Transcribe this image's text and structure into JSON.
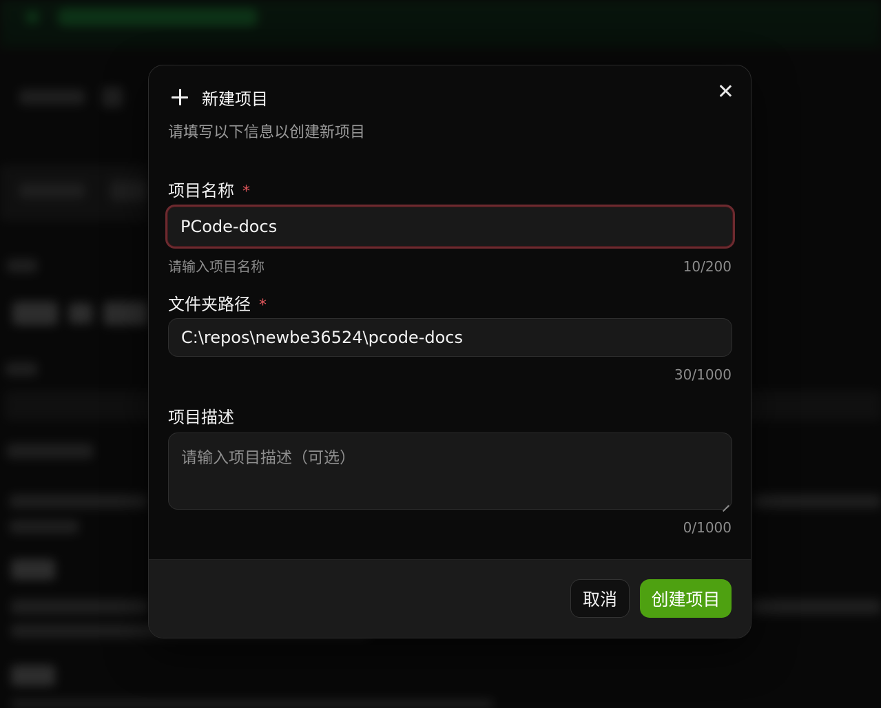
{
  "dialog": {
    "title": "新建项目",
    "subtitle": "请填写以下信息以创建新项目",
    "close_icon": "close-icon",
    "title_icon": "plus-icon"
  },
  "fields": {
    "name": {
      "label": "项目名称",
      "required": "*",
      "value": "PCode-docs",
      "helper": "请输入项目名称",
      "counter": "10/200"
    },
    "path": {
      "label": "文件夹路径",
      "required": "*",
      "value": "C:\\repos\\newbe36524\\pcode-docs",
      "counter": "30/1000"
    },
    "description": {
      "label": "项目描述",
      "placeholder": "请输入项目描述（可选）",
      "counter": "0/1000"
    }
  },
  "footer": {
    "cancel_label": "取消",
    "create_label": "创建项目"
  },
  "colors": {
    "accent_green": "#4ea111",
    "required_red": "#e0565b",
    "focus_border": "#6d2a2f"
  }
}
